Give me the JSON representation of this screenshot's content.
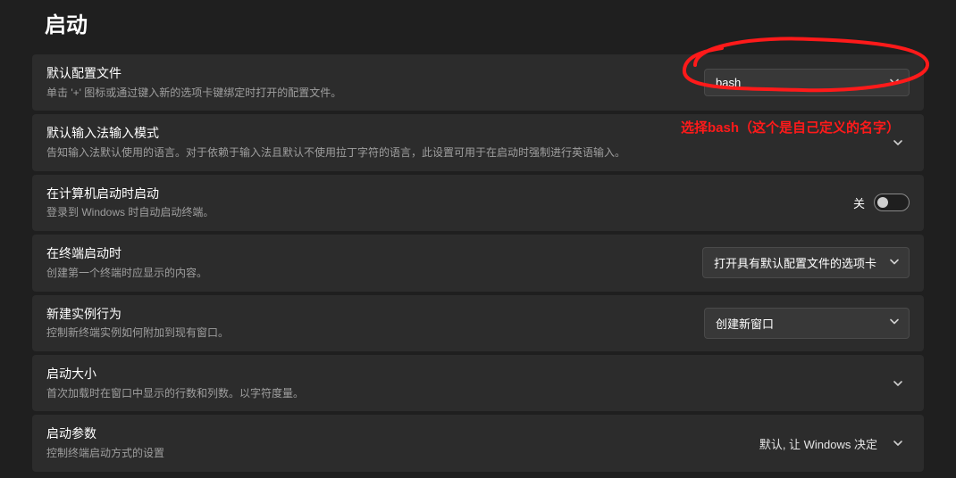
{
  "page": {
    "title": "启动"
  },
  "annotation": {
    "text": "选择bash（这个是自己定义的名字）"
  },
  "rows": {
    "defaultProfile": {
      "label": "默认配置文件",
      "desc": "单击 '+' 图标或通过键入新的选项卡键绑定时打开的配置文件。",
      "value": "bash"
    },
    "ime": {
      "label": "默认输入法输入模式",
      "desc": "告知输入法默认使用的语言。对于依赖于输入法且默认不使用拉丁字符的语言，此设置可用于在启动时强制进行英语输入。"
    },
    "launchOnStart": {
      "label": "在计算机启动时启动",
      "desc": "登录到 Windows 时自动启动终端。",
      "toggleLabel": "关"
    },
    "onTerminalStart": {
      "label": "在终端启动时",
      "desc": "创建第一个终端时应显示的内容。",
      "value": "打开具有默认配置文件的选项卡"
    },
    "newInstance": {
      "label": "新建实例行为",
      "desc": "控制新终端实例如何附加到现有窗口。",
      "value": "创建新窗口"
    },
    "launchSize": {
      "label": "启动大小",
      "desc": "首次加载时在窗口中显示的行数和列数。以字符度量。"
    },
    "launchParams": {
      "label": "启动参数",
      "desc": "控制终端启动方式的设置",
      "value": "默认, 让 Windows 决定"
    }
  }
}
